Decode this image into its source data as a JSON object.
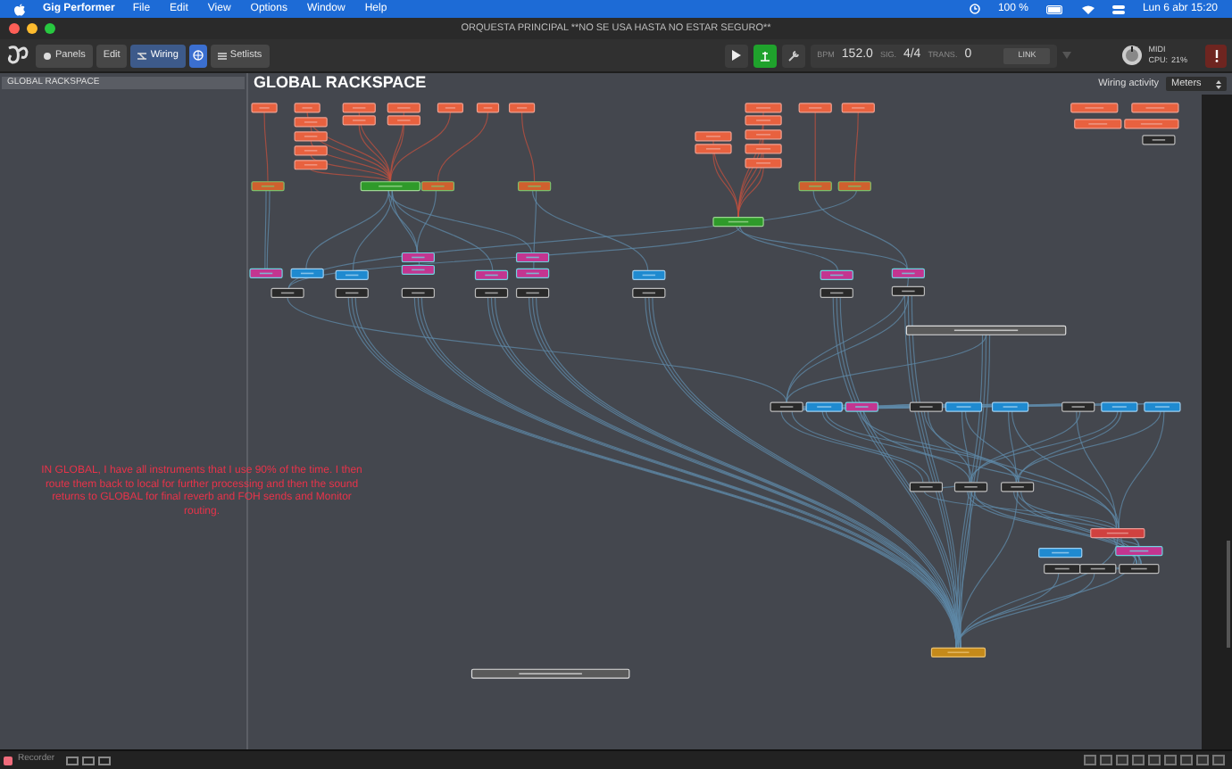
{
  "menu_bar": {
    "app": "Gig Performer",
    "items": [
      "File",
      "Edit",
      "View",
      "Options",
      "Window",
      "Help"
    ],
    "battery": "100 %",
    "clock": "Lun 6 abr 15:20"
  },
  "window": {
    "title": "ORQUESTA PRINCIPAL **NO SE USA HASTA NO ESTAR SEGURO**"
  },
  "tabs": [
    {
      "label": "Panels",
      "selected": false
    },
    {
      "label": "Edit",
      "selected": false
    },
    {
      "label": "Wiring",
      "selected": true
    },
    {
      "label": "Setlists",
      "selected": false
    }
  ],
  "transport": {
    "bpm_label": "BPM",
    "bpm": "152.0",
    "sig_label": "SIG.",
    "sig": "4/4",
    "trans_label": "TRANS.",
    "trans": "0",
    "link": "LINK",
    "midi": "MIDI",
    "cpu_label": "CPU:",
    "cpu": "21%"
  },
  "sidebar": {
    "items": [
      {
        "label": "GLOBAL RACKSPACE",
        "selected": true
      }
    ]
  },
  "canvas": {
    "title": "GLOBAL RACKSPACE",
    "wiring_activity_label": "Wiring activity",
    "wiring_activity": "Meters",
    "annotation": "IN GLOBAL, I have all instruments that I use 90% of the time. I then route them back to local for further processing and then the sound returns to GLOBAL for final reverb and FOH sends and Monitor routing."
  },
  "bottom_bar": {
    "recorder": "Recorder"
  }
}
